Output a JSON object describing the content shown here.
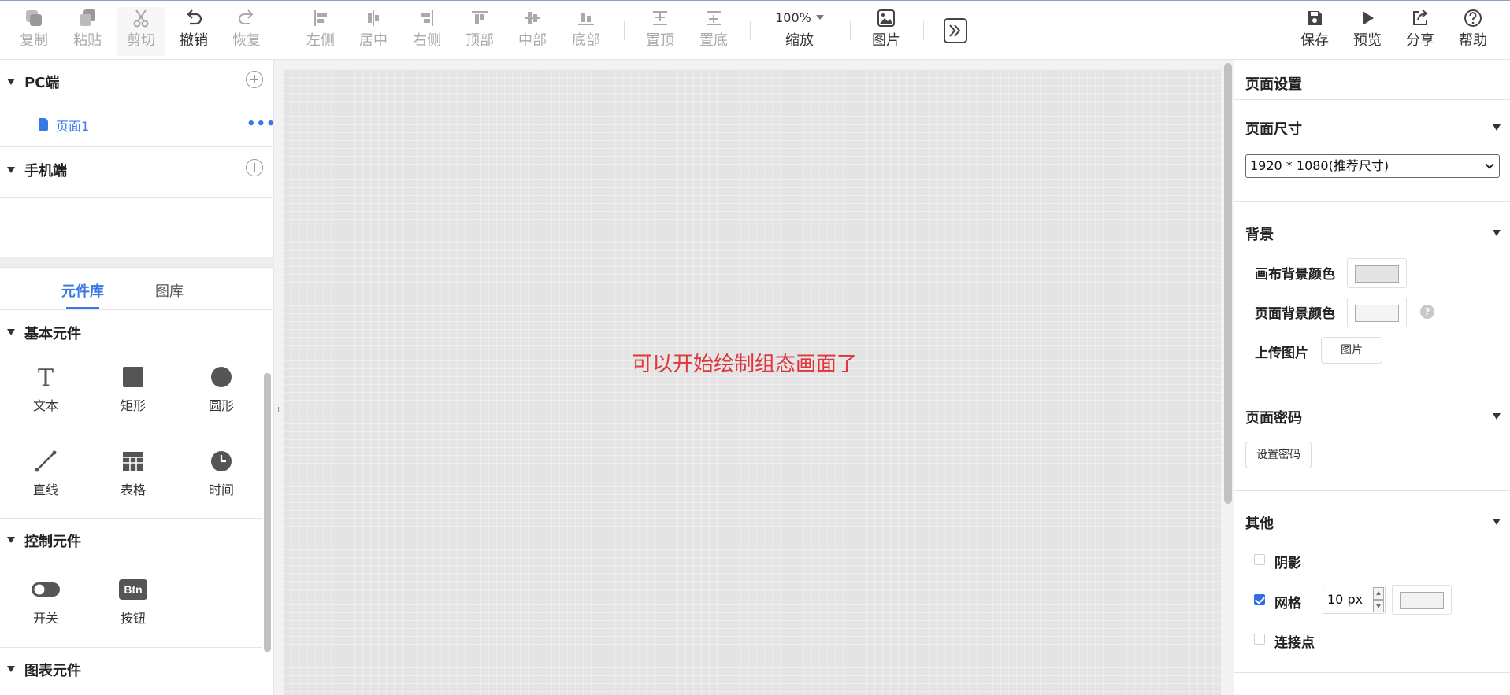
{
  "toolbar": {
    "copy": "复制",
    "paste": "粘贴",
    "cut": "剪切",
    "undo": "撤销",
    "redo": "恢复",
    "align_left": "左侧",
    "align_center": "居中",
    "align_right": "右侧",
    "align_top": "顶部",
    "align_middle": "中部",
    "align_bottom": "底部",
    "bring_front": "置顶",
    "send_back": "置底",
    "zoom_value": "100%",
    "zoom": "缩放",
    "image": "图片",
    "save": "保存",
    "preview": "预览",
    "share": "分享",
    "help": "帮助"
  },
  "pages": {
    "pc_title": "PC端",
    "pc_pages": [
      "页面1"
    ],
    "mobile_title": "手机端"
  },
  "library": {
    "tabs": [
      "元件库",
      "图库"
    ],
    "basic_title": "基本元件",
    "basic_items": [
      "文本",
      "矩形",
      "圆形",
      "直线",
      "表格",
      "时间"
    ],
    "control_title": "控制元件",
    "control_items": [
      "开关",
      "按钮"
    ],
    "button_icon_text": "Btn",
    "chart_title": "图表元件"
  },
  "canvas": {
    "message": "可以开始绘制组态画面了",
    "message_color": "#e0353b",
    "grid_color": "#eeeeee",
    "background_color": "#e4e4e4"
  },
  "settings": {
    "title": "页面设置",
    "size_section": "页面尺寸",
    "size_value": "1920 * 1080(推荐尺寸)",
    "bg_section": "背景",
    "canvas_bg_label": "画布背景颜色",
    "page_bg_label": "页面背景颜色",
    "upload_label": "上传图片",
    "upload_button": "图片",
    "password_section": "页面密码",
    "set_password_button": "设置密码",
    "other_section": "其他",
    "shadow_label": "阴影",
    "grid_label": "网格",
    "grid_size": "10 px",
    "connect_label": "连接点",
    "shadow_checked": false,
    "grid_checked": true,
    "connect_checked": false
  },
  "colors": {
    "accent": "#3a78e8",
    "checkbox": "#2f6fe0"
  }
}
